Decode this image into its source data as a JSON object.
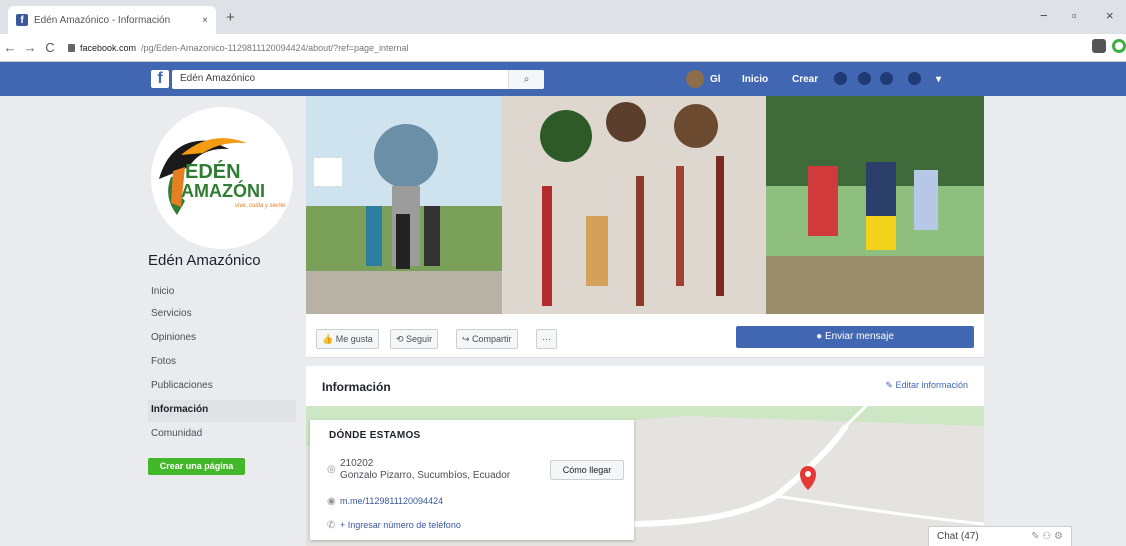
{
  "browser": {
    "tab_title": "Edén Amazónico - Información",
    "tab_close": "×",
    "new_tab": "+",
    "url_domain": "facebook.com",
    "url_path": "/pg/Eden-Amazonico-1129811120094424/about/?ref=page_internal",
    "back": "←",
    "forward": "→",
    "reload": "C",
    "minimize": "−",
    "maximize": "▫",
    "close": "×"
  },
  "fb": {
    "logo": "f",
    "search_value": "Edén Amazónico",
    "search_icon": "🔍",
    "user": "Gl",
    "home": "Inicio",
    "create": "Crear"
  },
  "page": {
    "name": "Edén Amazónico",
    "logo_line1": "EDÉN",
    "logo_line2": "AMAZÓNI",
    "logo_tagline": "vive, cuida y siente",
    "nav": [
      "Inicio",
      "Servicios",
      "Opiniones",
      "Fotos",
      "Publicaciones",
      "Información",
      "Comunidad"
    ],
    "create_page": "Crear una página"
  },
  "actions": {
    "like": "Me gusta",
    "follow": "Seguir",
    "share": "Compartir",
    "more": "···",
    "send_message": "Enviar mensaje"
  },
  "info": {
    "title": "Información",
    "edit": "Editar información",
    "where_heading": "DÓNDE ESTAMOS",
    "postal": "210202",
    "address": "Gonzalo Pizarro, Sucumbíos, Ecuador",
    "directions": "Cómo llegar",
    "messenger": "m.me/1129811120094424",
    "phone": "+ Ingresar número de teléfono"
  },
  "chat": {
    "label": "Chat (47)"
  },
  "colors": {
    "fb_blue": "#4267b2",
    "green": "#42b72a",
    "map_pin": "#e53935"
  }
}
